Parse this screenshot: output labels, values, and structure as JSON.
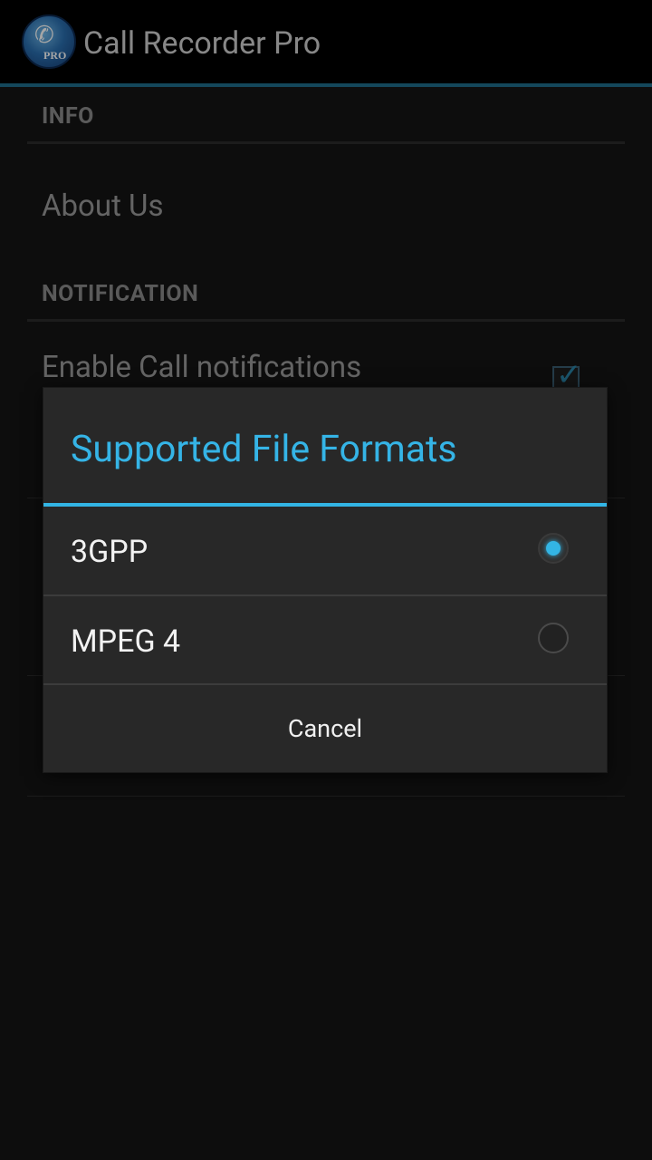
{
  "app": {
    "title": "Call Recorder Pro",
    "icon_name": "call-recorder-app-icon",
    "icon_text": "PRO"
  },
  "prefs": {
    "info_category": "INFO",
    "about_title": "About Us",
    "notification_category": "NOTIFICATION",
    "enable_notifications_title": "Enable Call notifications",
    "enable_notifications_checked": true
  },
  "dialog": {
    "title": "Supported File Formats",
    "options": [
      {
        "label": "3GPP",
        "selected": true
      },
      {
        "label": "MPEG 4",
        "selected": false
      }
    ],
    "cancel_label": "Cancel"
  },
  "colors": {
    "accent": "#33b5e5",
    "actionbar": "#000000",
    "dialog_bg": "#282828"
  }
}
